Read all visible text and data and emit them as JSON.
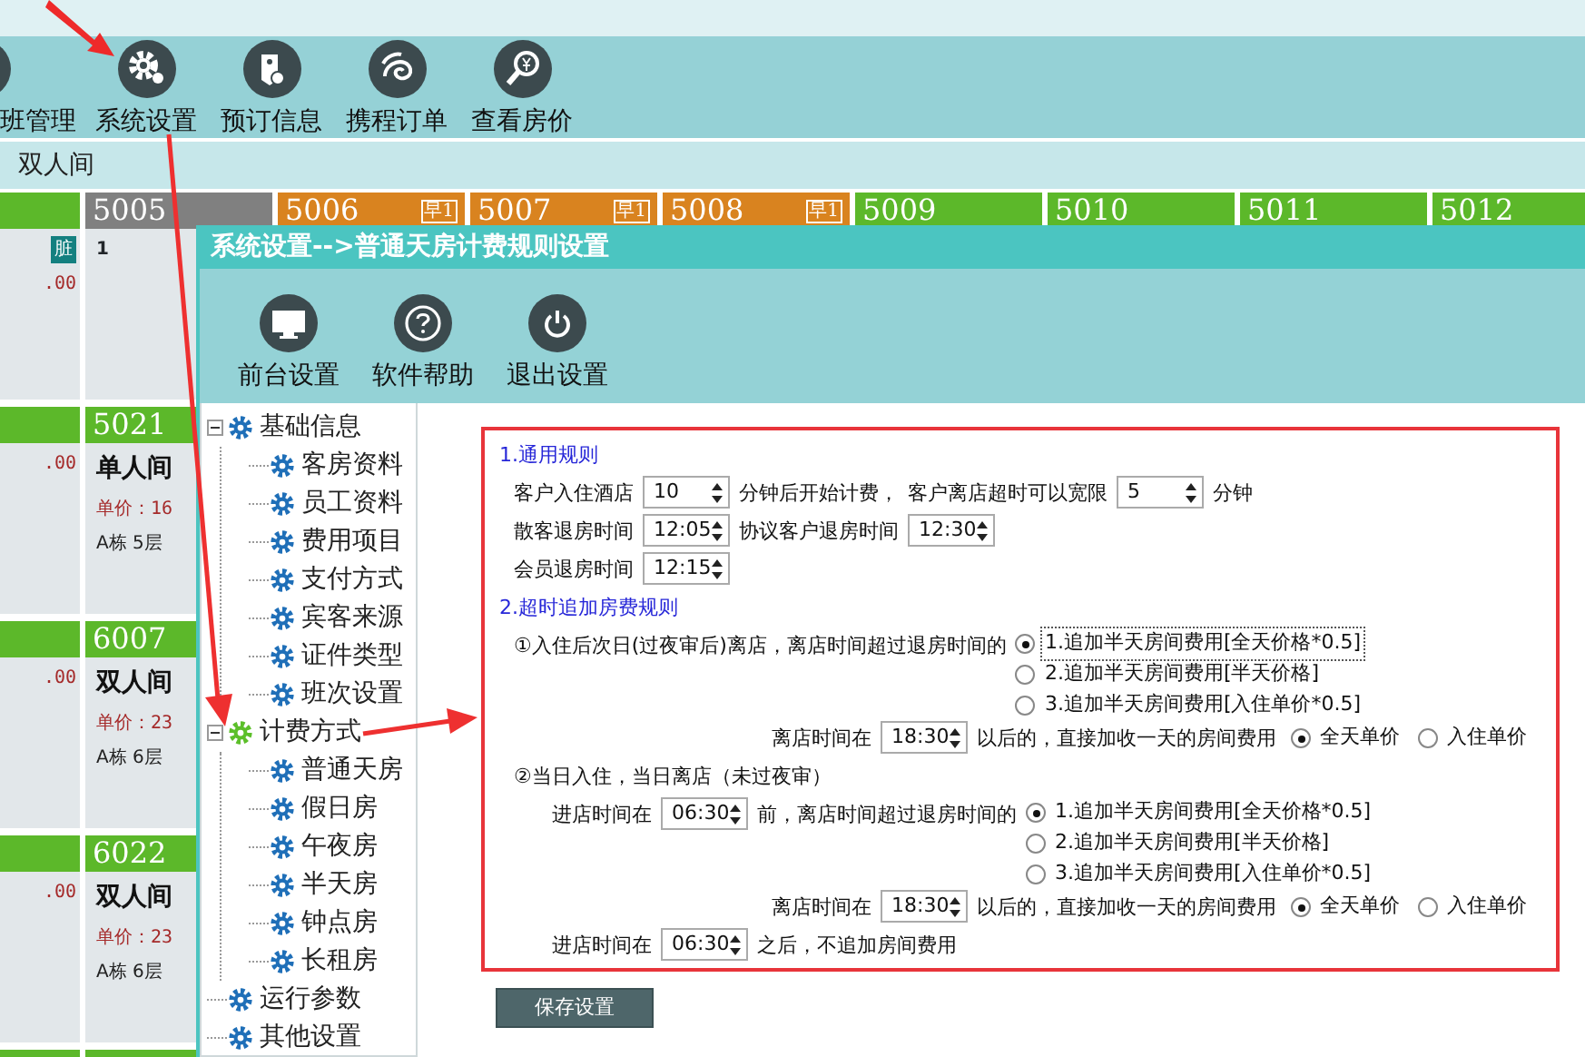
{
  "app_toolbar": [
    {
      "label": "班管理",
      "kind": "person"
    },
    {
      "label": "系统设置",
      "kind": "gears"
    },
    {
      "label": "预订信息",
      "kind": "tag"
    },
    {
      "label": "携程订单",
      "kind": "swirl"
    },
    {
      "label": "查看房价",
      "kind": "magnifier"
    }
  ],
  "room_type_bar": "双人间",
  "room_rows": [
    [
      {
        "color": "#5cb82a",
        "lines": [
          {
            "kind": "badge",
            "text": "脏"
          },
          {
            "kind": "price",
            "text": ".00"
          }
        ]
      },
      {
        "number": "5005",
        "color": "#808080",
        "lines": [
          {
            "kind": "note",
            "text": "1"
          }
        ]
      },
      {
        "number": "5006",
        "color": "#d9831f",
        "tag": "早1"
      },
      {
        "number": "5007",
        "color": "#d9831f",
        "tag": "早1"
      },
      {
        "number": "5008",
        "color": "#d9831f",
        "tag": "早1"
      },
      {
        "number": "5009",
        "color": "#5cb82a"
      },
      {
        "number": "5010",
        "color": "#5cb82a"
      },
      {
        "number": "5011",
        "color": "#5cb82a"
      },
      {
        "number": "5012",
        "color": "#5cb82a"
      }
    ],
    [
      {
        "color": "#5cb82a",
        "lines": [
          {
            "kind": "price",
            "text": ".00"
          }
        ]
      },
      {
        "number": "5021",
        "color": "#5cb82a",
        "lines": [
          {
            "kind": "type",
            "text": "单人间"
          },
          {
            "kind": "price",
            "text": "单价：16"
          },
          {
            "kind": "location",
            "text": "A栋 5层"
          }
        ]
      }
    ],
    [
      {
        "color": "#5cb82a",
        "lines": [
          {
            "kind": "price",
            "text": ".00"
          }
        ]
      },
      {
        "number": "6007",
        "color": "#5cb82a",
        "lines": [
          {
            "kind": "type",
            "text": "双人间"
          },
          {
            "kind": "price",
            "text": "单价：23"
          },
          {
            "kind": "location",
            "text": "A栋 6层"
          }
        ]
      }
    ],
    [
      {
        "color": "#5cb82a",
        "lines": [
          {
            "kind": "price",
            "text": ".00"
          }
        ]
      },
      {
        "number": "6022",
        "color": "#5cb82a",
        "lines": [
          {
            "kind": "type",
            "text": "双人间"
          },
          {
            "kind": "price",
            "text": "单价：23"
          },
          {
            "kind": "location",
            "text": "A栋 6层"
          }
        ]
      }
    ],
    [
      {
        "color": "#5cb82a"
      },
      {
        "color": "#5cb82a"
      }
    ]
  ],
  "dialog": {
    "title": "系统设置-->普通天房计费规则设置",
    "toolbar": [
      {
        "label": "前台设置",
        "kind": "monitor"
      },
      {
        "label": "软件帮助",
        "kind": "help"
      },
      {
        "label": "退出设置",
        "kind": "power"
      }
    ],
    "tree": [
      {
        "label": "基础信息",
        "expanded": true,
        "active": false,
        "children": [
          {
            "label": "客房资料",
            "active": false
          },
          {
            "label": "员工资料",
            "active": false
          },
          {
            "label": "费用项目",
            "active": false
          },
          {
            "label": "支付方式",
            "active": false
          },
          {
            "label": "宾客来源",
            "active": false
          },
          {
            "label": "证件类型",
            "active": false
          },
          {
            "label": "班次设置",
            "active": false
          }
        ]
      },
      {
        "label": "计费方式",
        "expanded": true,
        "active": true,
        "children": [
          {
            "label": "普通天房",
            "active": false
          },
          {
            "label": "假日房",
            "active": false
          },
          {
            "label": "午夜房",
            "active": false
          },
          {
            "label": "半天房",
            "active": false
          },
          {
            "label": "钟点房",
            "active": false
          },
          {
            "label": "长租房",
            "active": false
          }
        ]
      },
      {
        "label": "运行参数",
        "active": false
      },
      {
        "label": "其他设置",
        "active": false
      }
    ],
    "form": {
      "rows": [
        {
          "kind": "heading",
          "items": [
            {
              "kind": "text",
              "text": "1.通用规则"
            }
          ]
        },
        {
          "kind": "line",
          "items": [
            {
              "kind": "text",
              "text": "客户入住酒店"
            },
            {
              "kind": "spin",
              "value": "10"
            },
            {
              "kind": "text",
              "text": "分钟后开始计费，"
            },
            {
              "kind": "text",
              "text": "客户离店超时可以宽限"
            },
            {
              "kind": "spin",
              "value": "5"
            },
            {
              "kind": "text",
              "text": "分钟"
            }
          ]
        },
        {
          "kind": "line",
          "items": [
            {
              "kind": "text",
              "text": "散客退房时间"
            },
            {
              "kind": "spin",
              "value": "12:05"
            },
            {
              "kind": "text",
              "text": "协议客户退房时间"
            },
            {
              "kind": "spin",
              "value": "12:30"
            }
          ]
        },
        {
          "kind": "line",
          "items": [
            {
              "kind": "text",
              "text": "会员退房时间"
            },
            {
              "kind": "spin",
              "value": "12:15"
            }
          ]
        },
        {
          "kind": "heading",
          "items": [
            {
              "kind": "text",
              "text": "2.超时追加房费规则"
            }
          ]
        },
        {
          "kind": "line",
          "items": [
            {
              "kind": "text",
              "text": "①入住后次日(过夜审后)离店，离店时间超过退房时间的"
            },
            {
              "kind": "radios",
              "options": [
                {
                  "label": "1.追加半天房间费用[全天价格*0.5]",
                  "selected": true,
                  "focused": true
                },
                {
                  "label": "2.追加半天房间费用[半天价格]",
                  "selected": false,
                  "focused": false
                },
                {
                  "label": "3.追加半天房间费用[入住单价*0.5]",
                  "selected": false,
                  "focused": false
                }
              ]
            }
          ]
        },
        {
          "kind": "charge",
          "items": [
            {
              "kind": "text",
              "text": "离店时间在"
            },
            {
              "kind": "spin",
              "value": "18:30"
            },
            {
              "kind": "text",
              "text": "以后的，直接加收一天的房间费用"
            },
            {
              "kind": "radio",
              "label": "全天单价",
              "selected": true,
              "focused": false
            },
            {
              "kind": "radio",
              "label": "入住单价",
              "selected": false,
              "focused": false
            }
          ]
        },
        {
          "kind": "line",
          "items": [
            {
              "kind": "text",
              "text": "②当日入住，当日离店（未过夜审）"
            }
          ]
        },
        {
          "kind": "sub",
          "items": [
            {
              "kind": "text",
              "text": "进店时间在"
            },
            {
              "kind": "spin",
              "value": "06:30"
            },
            {
              "kind": "text",
              "text": "前，离店时间超过退房时间的"
            },
            {
              "kind": "radios",
              "options": [
                {
                  "label": "1.追加半天房间费用[全天价格*0.5]",
                  "selected": true,
                  "focused": false
                },
                {
                  "label": "2.追加半天房间费用[半天价格]",
                  "selected": false,
                  "focused": false
                },
                {
                  "label": "3.追加半天房间费用[入住单价*0.5]",
                  "selected": false,
                  "focused": false
                }
              ]
            }
          ]
        },
        {
          "kind": "charge",
          "items": [
            {
              "kind": "text",
              "text": "离店时间在"
            },
            {
              "kind": "spin",
              "value": "18:30"
            },
            {
              "kind": "text",
              "text": "以后的，直接加收一天的房间费用"
            },
            {
              "kind": "radio",
              "label": "全天单价",
              "selected": true,
              "focused": false
            },
            {
              "kind": "radio",
              "label": "入住单价",
              "selected": false,
              "focused": false
            }
          ]
        },
        {
          "kind": "sub",
          "items": [
            {
              "kind": "text",
              "text": "进店时间在"
            },
            {
              "kind": "spin",
              "value": "06:30"
            },
            {
              "kind": "text",
              "text": "之后，不追加房间费用"
            }
          ]
        }
      ]
    },
    "save_button": "保存设置"
  }
}
